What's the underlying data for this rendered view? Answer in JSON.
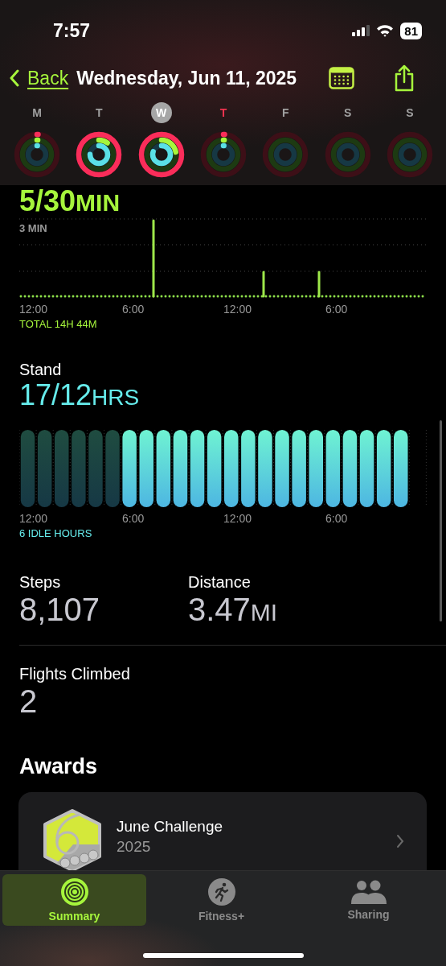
{
  "status_bar": {
    "time": "7:57",
    "battery": "81"
  },
  "nav": {
    "back": "Back",
    "title": "Wednesday, Jun 11, 2025"
  },
  "days": [
    {
      "letter": "M",
      "selected": false,
      "today": false
    },
    {
      "letter": "T",
      "selected": false,
      "today": false
    },
    {
      "letter": "W",
      "selected": true,
      "today": false
    },
    {
      "letter": "T",
      "selected": false,
      "today": true
    },
    {
      "letter": "F",
      "selected": false,
      "today": false
    },
    {
      "letter": "S",
      "selected": false,
      "today": false
    },
    {
      "letter": "S",
      "selected": false,
      "today": false
    }
  ],
  "exercise": {
    "value": "5/30",
    "unit": "MIN",
    "y_label": "3 MIN",
    "x_labels": [
      "12:00",
      "6:00",
      "12:00",
      "6:00"
    ],
    "total": "TOTAL 14H 44M"
  },
  "stand": {
    "label": "Stand",
    "value": "17/12",
    "unit": "HRS",
    "hours": [
      {
        "stood": false
      },
      {
        "stood": false
      },
      {
        "stood": false
      },
      {
        "stood": false
      },
      {
        "stood": false
      },
      {
        "stood": false
      },
      {
        "stood": true
      },
      {
        "stood": true
      },
      {
        "stood": true
      },
      {
        "stood": true
      },
      {
        "stood": true
      },
      {
        "stood": true
      },
      {
        "stood": true
      },
      {
        "stood": true
      },
      {
        "stood": true
      },
      {
        "stood": true
      },
      {
        "stood": true
      },
      {
        "stood": true
      },
      {
        "stood": true
      },
      {
        "stood": true
      },
      {
        "stood": true
      },
      {
        "stood": true
      },
      {
        "stood": true
      }
    ],
    "x_labels": [
      "12:00",
      "6:00",
      "12:00",
      "6:00"
    ],
    "idle": "6 IDLE HOURS"
  },
  "stats": [
    {
      "label": "Steps",
      "value": "8,107"
    },
    {
      "label": "Distance",
      "value": "3.47",
      "unit": "MI"
    }
  ],
  "flights": {
    "label": "Flights Climbed",
    "value": "2"
  },
  "awards": {
    "heading": "Awards",
    "items": [
      {
        "title": "June Challenge",
        "subtitle": "2025"
      }
    ]
  },
  "tabs": [
    {
      "label": "Summary",
      "selected": true
    },
    {
      "label": "Fitness+",
      "selected": false
    },
    {
      "label": "Sharing",
      "selected": false
    }
  ]
}
